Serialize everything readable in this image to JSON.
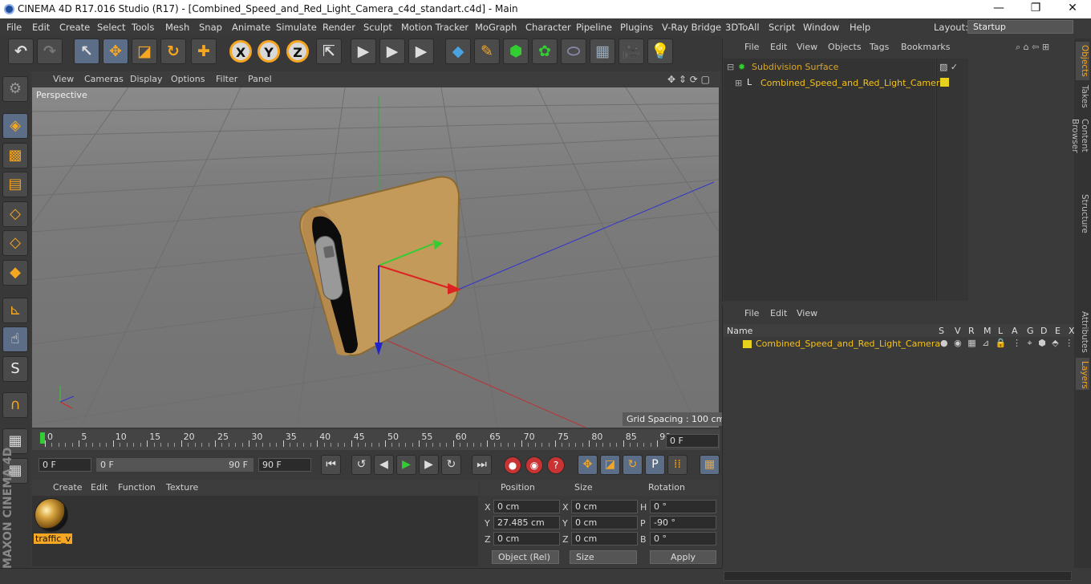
{
  "window": {
    "title": "CINEMA 4D R17.016 Studio (R17) - [Combined_Speed_and_Red_Light_Camera_c4d_standart.c4d] - Main",
    "minimize": "—",
    "maximize": "❐",
    "close": "✕"
  },
  "menu": [
    "File",
    "Edit",
    "Create",
    "Select",
    "Tools",
    "Mesh",
    "Snap",
    "Animate",
    "Simulate",
    "Render",
    "Sculpt",
    "Motion Tracker",
    "MoGraph",
    "Character",
    "Pipeline",
    "Plugins",
    "V-Ray Bridge",
    "3DToAll",
    "Script",
    "Window",
    "Help"
  ],
  "layout": {
    "label": "Layout:",
    "value": "Startup"
  },
  "viewport": {
    "menu": [
      "View",
      "Cameras",
      "Display",
      "Options",
      "Filter",
      "Panel"
    ],
    "label": "Perspective",
    "grid_spacing": "Grid Spacing : 100 cm"
  },
  "timeline": {
    "ticks": [
      "0",
      "5",
      "10",
      "15",
      "20",
      "25",
      "30",
      "35",
      "40",
      "45",
      "50",
      "55",
      "60",
      "65",
      "70",
      "75",
      "80",
      "85",
      "90"
    ],
    "current_frame": "0 F"
  },
  "transport": {
    "start": "0 F",
    "range_start": "0 F",
    "range_end": "90 F",
    "end": "90 F"
  },
  "material_manager": {
    "menu": [
      "Create",
      "Edit",
      "Function",
      "Texture"
    ],
    "material_name": "traffic_v"
  },
  "coordinates": {
    "headers": [
      "Position",
      "Size",
      "Rotation"
    ],
    "position": {
      "x": "0 cm",
      "y": "27.485 cm",
      "z": "0 cm"
    },
    "size": {
      "x": "0 cm",
      "y": "0 cm",
      "z": "0 cm"
    },
    "rotation": {
      "h": "0 °",
      "p": "-90 °",
      "b": "0 °"
    },
    "labels": {
      "x": "X",
      "y": "Y",
      "z": "Z",
      "h": "H",
      "p": "P",
      "b": "B"
    },
    "mode": "Object (Rel)",
    "size_mode": "Size",
    "apply": "Apply"
  },
  "object_manager": {
    "menu": [
      "File",
      "Edit",
      "View",
      "Objects",
      "Tags",
      "Bookmarks"
    ],
    "objects": [
      "Subdivision Surface",
      "Combined_Speed_and_Red_Light_Camera"
    ]
  },
  "layer_manager": {
    "menu": [
      "File",
      "Edit",
      "View"
    ],
    "columns": [
      "Name",
      "S",
      "V",
      "R",
      "M",
      "L",
      "A",
      "G",
      "D",
      "E",
      "X"
    ],
    "layer": "Combined_Speed_and_Red_Light_Camera"
  },
  "side_tabs": [
    "Objects",
    "Takes",
    "Content Browser",
    "Structure",
    "Attributes",
    "Layers"
  ],
  "brand": "MAXON CINEMA 4D",
  "colors": {
    "accent": "#f5a623",
    "layer_yellow": "#e6d21e",
    "x_axis": "#d22",
    "y_axis": "#2c2",
    "z_axis": "#22c"
  }
}
